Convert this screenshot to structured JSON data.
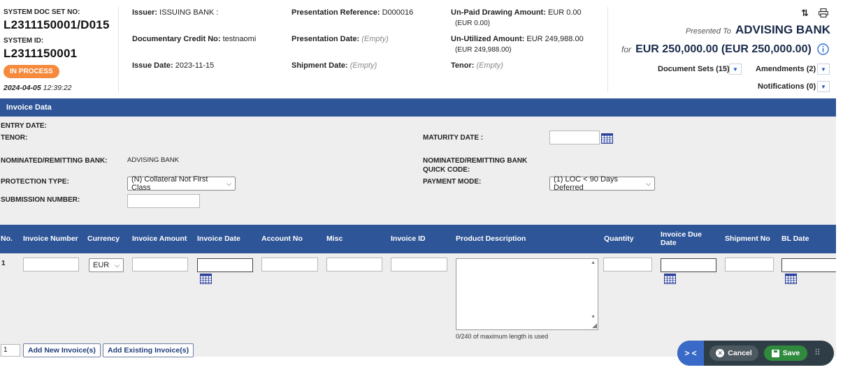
{
  "header": {
    "sys_doc_set_label": "SYSTEM DOC SET NO:",
    "sys_doc_set_value": "L2311150001/D015",
    "system_id_label": "SYSTEM ID:",
    "system_id_value": "L2311150001",
    "status": "IN PROCESS",
    "date": "2024-04-05",
    "time": "12:39:22",
    "issuer_label": "Issuer:",
    "issuer_value": "ISSUING BANK :",
    "dc_no_label": "Documentary Credit No:",
    "dc_no_value": "testnaomi",
    "issue_date_label": "Issue Date:",
    "issue_date_value": "2023-11-15",
    "pres_ref_label": "Presentation Reference:",
    "pres_ref_value": "D000016",
    "pres_date_label": "Presentation Date:",
    "pres_date_value": "(Empty)",
    "ship_date_label": "Shipment Date:",
    "ship_date_value": "(Empty)",
    "unpaid_label": "Un-Paid Drawing Amount:",
    "unpaid_value": "EUR 0.00",
    "unpaid_sub": "(EUR 0.00)",
    "unutil_label": "Un-Utilized Amount:",
    "unutil_value": "EUR 249,988.00",
    "unutil_sub": "(EUR 249,988.00)",
    "tenor_label": "Tenor:",
    "tenor_value": "(Empty)",
    "presented_to_label": "Presented To",
    "presented_to_value": "ADVISING BANK",
    "for_label": "for",
    "for_value": "EUR 250,000.00 (EUR 250,000.00)",
    "document_sets": "Document Sets (15)",
    "amendments": "Amendments (2)",
    "notifications": "Notifications (0)"
  },
  "section": {
    "title": "Invoice Data"
  },
  "form": {
    "entry_date_label": "ENTRY DATE:",
    "tenor_label": "TENOR:",
    "maturity_label": "MATURITY DATE :",
    "nominated_label": "NOMINATED/REMITTING BANK:",
    "nominated_value": "ADVISING BANK",
    "quick_code_label_1": "NOMINATED/REMITTING BANK",
    "quick_code_label_2": "QUICK CODE:",
    "protection_label": "PROTECTION TYPE:",
    "protection_value": "(N) Collateral Not First Class",
    "payment_label": "PAYMENT MODE:",
    "payment_value": "(1) LOC < 90 Days Deferred",
    "submission_label": "SUBMISSION NUMBER:"
  },
  "table": {
    "columns": [
      "No.",
      "Invoice Number",
      "Currency",
      "Invoice Amount",
      "Invoice Date",
      "Account No",
      "Misc",
      "Invoice ID",
      "Product Description",
      "Quantity",
      "Invoice Due",
      "Date",
      "Shipment No",
      "BL Date"
    ],
    "row_no": "1",
    "currency_value": "EUR",
    "char_count": "0/240 of maximum length is used"
  },
  "actions": {
    "count_value": "1",
    "add_new": "Add New Invoice(s)",
    "add_existing": "Add Existing Invoice(s)",
    "cancel": "Cancel",
    "save": "Save"
  },
  "colors": {
    "primary_blue": "#2e5597",
    "status_orange": "#f58a3c",
    "save_green": "#2f8a3e"
  }
}
